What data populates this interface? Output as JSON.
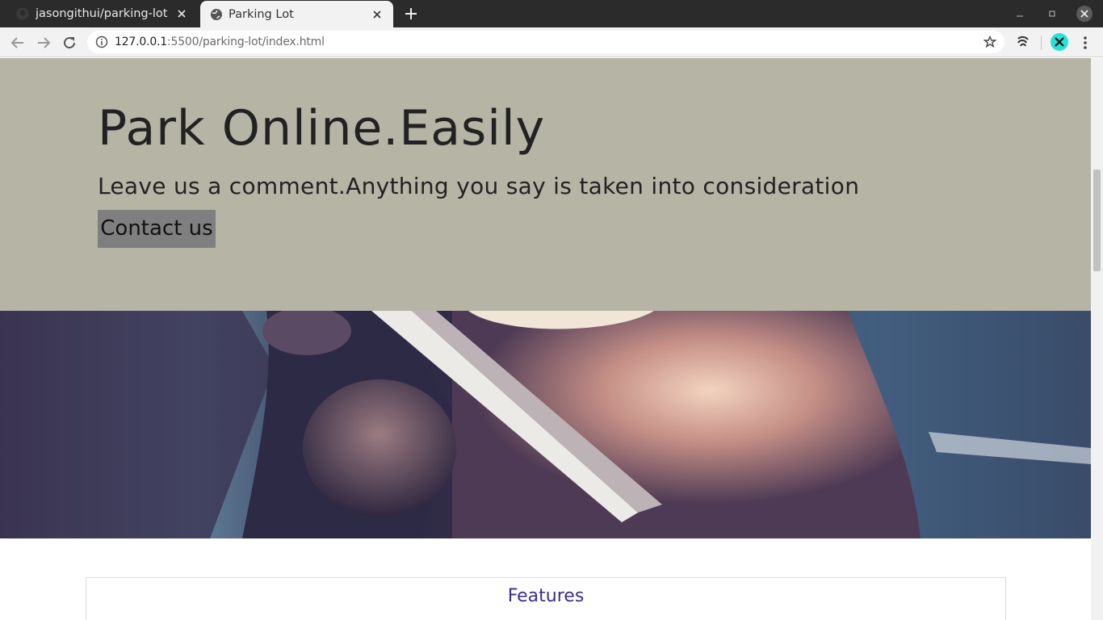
{
  "browser": {
    "tabs": [
      {
        "title": "jasongithui/parking-lot",
        "favicon": "github-icon",
        "active": false
      },
      {
        "title": "Parking Lot",
        "favicon": "globe-icon",
        "active": true
      }
    ],
    "url_host": "127.0.0.1",
    "url_path": ":5500/parking-lot/index.html",
    "avatar_color": "#28e0d8"
  },
  "hero": {
    "title": "Park Online.Easily",
    "subtitle": "Leave us a comment.Anything you say is taken into consideration",
    "cta_label": "Contact us",
    "background": "#b5b4a5"
  },
  "features": {
    "heading": "Features",
    "heading_color": "#3b2f8a"
  }
}
